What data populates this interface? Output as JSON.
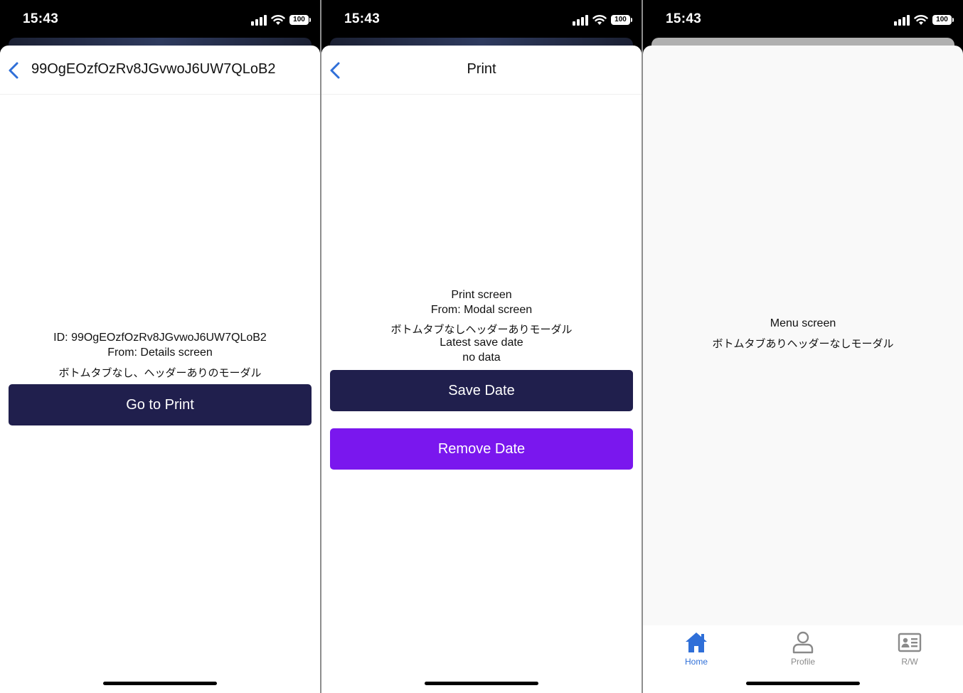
{
  "status_bar": {
    "time": "15:43",
    "battery": "100"
  },
  "colors": {
    "navy_button": "#201f4d",
    "purple_button": "#7a17ee",
    "back_chevron": "#2f6fd8",
    "active_tab": "#2f6fd8",
    "inactive_tab": "#8a8a8a"
  },
  "screens": [
    {
      "header_title": "99OgEOzfOzRv8JGvwoJ6UW7QLoB2",
      "lines": [
        "ID: 99OgEOzfOzRv8JGvwoJ6UW7QLoB2",
        "From: Details screen",
        "ボトムタブなし、ヘッダーありのモーダル"
      ],
      "button_label": "Go to Print"
    },
    {
      "header_title": "Print",
      "lines": [
        "Print screen",
        "From: Modal screen",
        "ボトムタブなしヘッダーありモーダル",
        "Latest save date",
        "no data"
      ],
      "save_button_label": "Save Date",
      "remove_button_label": "Remove Date"
    },
    {
      "lines": [
        "Menu screen",
        "ボトムタブありヘッダーなしモーダル"
      ],
      "tabs": [
        {
          "label": "Home",
          "icon": "home-icon",
          "active": true
        },
        {
          "label": "Profile",
          "icon": "person-icon",
          "active": false
        },
        {
          "label": "R/W",
          "icon": "id-card-icon",
          "active": false
        }
      ]
    }
  ]
}
